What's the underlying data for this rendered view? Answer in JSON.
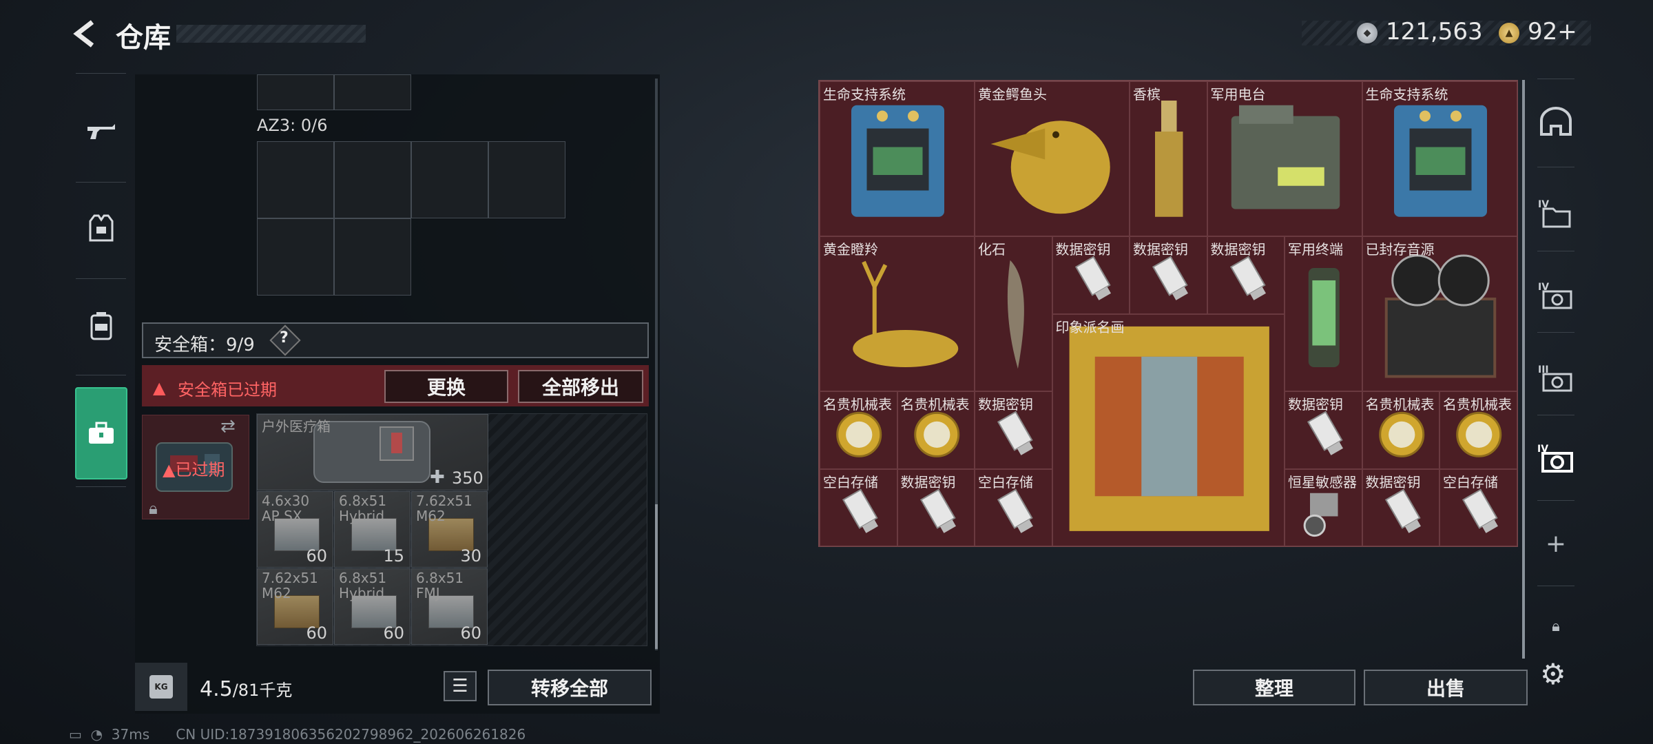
{
  "header": {
    "title": "仓库",
    "back_icon": "back-arrow-icon"
  },
  "currency": {
    "silver": "121,563",
    "gold": "92",
    "gold_plus": "+"
  },
  "left_nav": {
    "items": [
      {
        "icon": "rifle-icon",
        "name": "weapons"
      },
      {
        "icon": "armor-vest-icon",
        "name": "armor"
      },
      {
        "icon": "backpack-icon",
        "name": "backpack"
      },
      {
        "icon": "toolbox-icon",
        "name": "safe-box",
        "selected": true
      }
    ]
  },
  "container": {
    "az3_label": "AZ3: 0/6",
    "safebox_label": "安全箱：9/9",
    "help": "?",
    "expired_warning": "安全箱已过期",
    "replace_button": "更换",
    "move_all_button": "全部移出",
    "case_expired": "已过期",
    "medkit": {
      "name": "户外医疗箱",
      "count": "350"
    },
    "ammo": [
      {
        "name": "4.6x30\nAP SX",
        "count": "60"
      },
      {
        "name": "6.8x51\nHybrid",
        "count": "15"
      },
      {
        "name": "7.62x51\nM62",
        "count": "30"
      },
      {
        "name": "7.62x51\nM62",
        "count": "60"
      },
      {
        "name": "6.8x51\nHybrid",
        "count": "60"
      },
      {
        "name": "6.8x51\nFMJ",
        "count": "60"
      }
    ]
  },
  "footer_left": {
    "weight_value": "4.5",
    "weight_max": "/81千克",
    "kg_icon_text": "KG",
    "transfer_all_button": "转移全部"
  },
  "status_bar": {
    "ping": "37ms",
    "uid": "CN UID:187391806356202798962_202606261826"
  },
  "stash": {
    "items": [
      {
        "label": "生命支持系统",
        "art": "lifesupport"
      },
      {
        "label": "黄金鳄鱼头",
        "art": "croc"
      },
      {
        "label": "香槟",
        "art": "champagne"
      },
      {
        "label": "军用电台",
        "art": "radio"
      },
      {
        "label": "生命支持系统",
        "art": "lifesupport"
      },
      {
        "label": "黄金瞪羚",
        "art": "gazelle"
      },
      {
        "label": "化石",
        "art": "fossil"
      },
      {
        "label": "数据密钥",
        "art": "datakey"
      },
      {
        "label": "数据密钥",
        "art": "datakey"
      },
      {
        "label": "数据密钥",
        "art": "datakey"
      },
      {
        "label": "军用终端",
        "art": "terminal"
      },
      {
        "label": "已封存音源",
        "art": "reel"
      },
      {
        "label": "印象派名画",
        "art": "painting"
      },
      {
        "label": "名贵机械表",
        "art": "watch"
      },
      {
        "label": "名贵机械表",
        "art": "watch"
      },
      {
        "label": "数据密钥",
        "art": "datakey"
      },
      {
        "label": "数据密钥",
        "art": "datakey"
      },
      {
        "label": "名贵机械表",
        "art": "watch"
      },
      {
        "label": "名贵机械表",
        "art": "watch"
      },
      {
        "label": "空白存储",
        "art": "datakey"
      },
      {
        "label": "数据密钥",
        "art": "datakey"
      },
      {
        "label": "空白存储",
        "art": "datakey"
      },
      {
        "label": "恒星敏感器",
        "art": "sensor"
      },
      {
        "label": "数据密钥",
        "art": "datakey"
      },
      {
        "label": "空白存储",
        "art": "datakey"
      }
    ],
    "sort_button": "整理",
    "sell_button": "出售"
  },
  "right_tabs": [
    {
      "icon": "helmet-icon"
    },
    {
      "icon": "folder-tab-iv-icon",
      "label": "IV"
    },
    {
      "icon": "camera-tab-iv-icon",
      "label": "IV"
    },
    {
      "icon": "camera-tab-iii-icon",
      "label": "III"
    },
    {
      "icon": "camera-tab-iv-active-icon",
      "label": "IV"
    },
    {
      "icon": "plus-icon",
      "label": "+"
    },
    {
      "icon": "lock-icon"
    }
  ],
  "colors": {
    "accent_green": "#2a9e73",
    "stash_bg": "#4b1e24",
    "warning_red": "#ff6464"
  }
}
